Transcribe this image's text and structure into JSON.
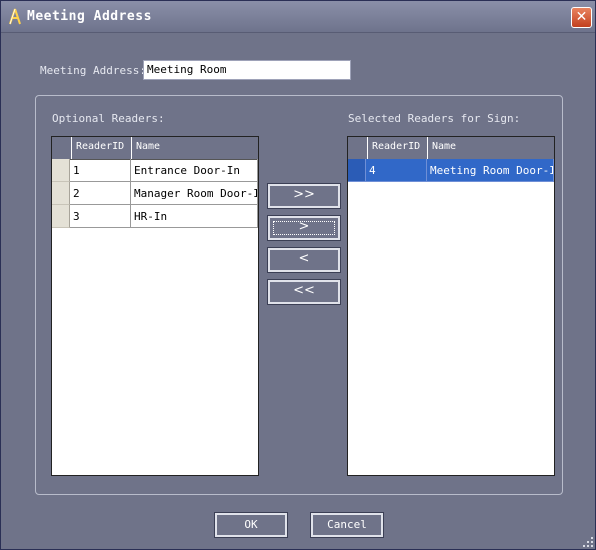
{
  "window": {
    "title": "Meeting Address",
    "close_glyph": "✕"
  },
  "address": {
    "label": "Meeting Address:",
    "value": "Meeting Room"
  },
  "optional": {
    "label": "Optional Readers:",
    "columns": [
      "ReaderID",
      "Name"
    ],
    "rows": [
      {
        "id": "1",
        "name": "Entrance Door-In"
      },
      {
        "id": "2",
        "name": "Manager Room Door-In"
      },
      {
        "id": "3",
        "name": "HR-In"
      }
    ]
  },
  "selected": {
    "label": "Selected Readers for Sign:",
    "columns": [
      "ReaderID",
      "Name"
    ],
    "rows": [
      {
        "id": "4",
        "name": "Meeting Room Door-In"
      }
    ]
  },
  "move_buttons": {
    "add_all": ">>",
    "add_one": ">",
    "remove_one": "<",
    "remove_all": "<<"
  },
  "dialog_buttons": {
    "ok": "OK",
    "cancel": "Cancel"
  },
  "colors": {
    "background": "#6f7389",
    "selection": "#3168c8",
    "close_button": "#c2401f"
  },
  "icons": {
    "title": "app-icon",
    "close": "close-icon",
    "resize": "resize-grip-icon"
  }
}
